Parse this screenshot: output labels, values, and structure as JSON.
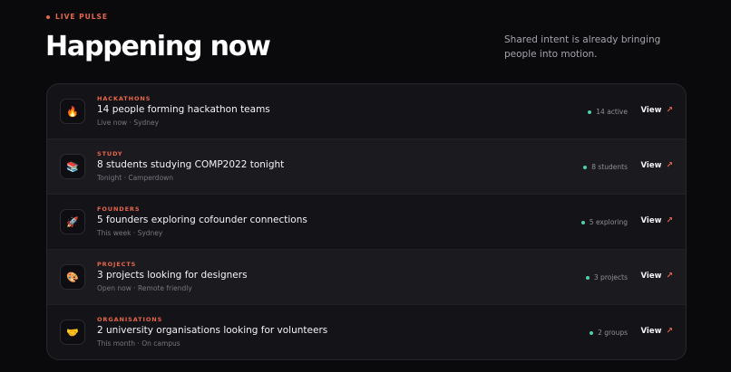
{
  "eyebrow": "LIVE PULSE",
  "title": "Happening now",
  "subtitle": "Shared intent is already bringing people into motion.",
  "rows": [
    {
      "category": "HACKATHONS",
      "headline": "14 people forming hackathon teams",
      "meta": "Live now · Sydney",
      "status": "14 active",
      "action": "View",
      "icon": "fire-icon",
      "glyph": "🔥"
    },
    {
      "category": "STUDY",
      "headline": "8 students studying COMP2022 tonight",
      "meta": "Tonight · Camperdown",
      "status": "8 students",
      "action": "View",
      "icon": "books-icon",
      "glyph": "📚"
    },
    {
      "category": "FOUNDERS",
      "headline": "5 founders exploring cofounder connections",
      "meta": "This week · Sydney",
      "status": "5 exploring",
      "action": "View",
      "icon": "rocket-icon",
      "glyph": "🚀"
    },
    {
      "category": "PROJECTS",
      "headline": "3 projects looking for designers",
      "meta": "Open now · Remote friendly",
      "status": "3 projects",
      "action": "View",
      "icon": "palette-icon",
      "glyph": "🎨"
    },
    {
      "category": "ORGANISATIONS",
      "headline": "2 university organisations looking for volunteers",
      "meta": "This month · On campus",
      "status": "2 groups",
      "action": "View",
      "icon": "handshake-icon",
      "glyph": "🤝"
    }
  ],
  "colors": {
    "accent": "#e8664a",
    "status_dot": "#4fd1a5",
    "background": "#0a0a0d",
    "panel": "#141418"
  }
}
